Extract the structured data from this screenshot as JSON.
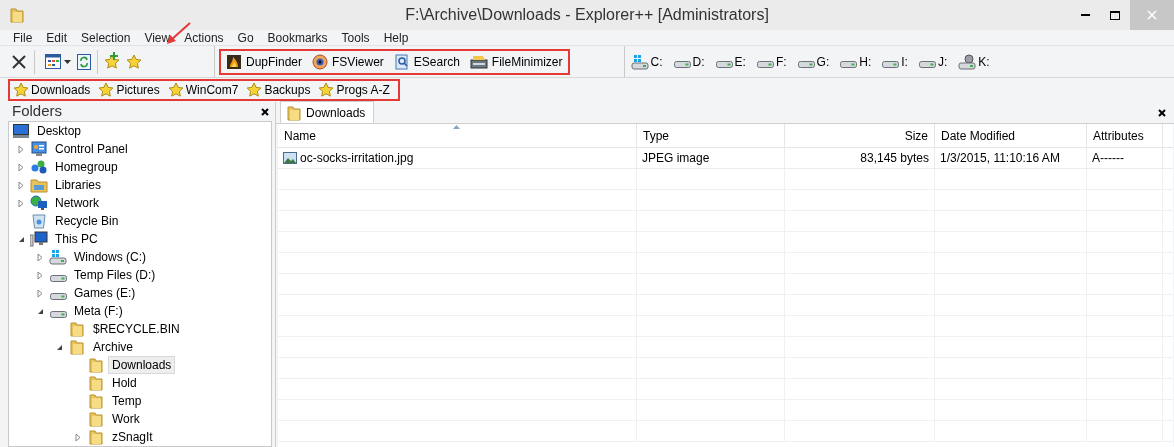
{
  "window": {
    "title": "F:\\Archive\\Downloads - Explorer++ [Administrators]"
  },
  "menu": [
    "File",
    "Edit",
    "Selection",
    "View",
    "Actions",
    "Go",
    "Bookmarks",
    "Tools",
    "Help"
  ],
  "apps": [
    {
      "label": "DupFinder",
      "kind": "flame"
    },
    {
      "label": "FSViewer",
      "kind": "eye"
    },
    {
      "label": "ESearch",
      "kind": "search"
    },
    {
      "label": "FileMinimizer",
      "kind": "scanner"
    }
  ],
  "drives": [
    {
      "label": "C:",
      "kind": "system"
    },
    {
      "label": "D:",
      "kind": "disk"
    },
    {
      "label": "E:",
      "kind": "disk"
    },
    {
      "label": "F:",
      "kind": "disk"
    },
    {
      "label": "G:",
      "kind": "disk"
    },
    {
      "label": "H:",
      "kind": "disk"
    },
    {
      "label": "I:",
      "kind": "disk"
    },
    {
      "label": "J:",
      "kind": "disk"
    },
    {
      "label": "K:",
      "kind": "network"
    }
  ],
  "bookmarks": [
    "Downloads",
    "Pictures",
    "WinCom7",
    "Backups",
    "Progs A-Z"
  ],
  "folders_panel": {
    "title": "Folders",
    "tree": [
      {
        "label": "Desktop",
        "kind": "desktop",
        "selected": false,
        "children": [
          {
            "label": "Control Panel",
            "kind": "control",
            "expanded": false,
            "selected": false
          },
          {
            "label": "Homegroup",
            "kind": "homegroup",
            "expanded": false,
            "selected": false
          },
          {
            "label": "Libraries",
            "kind": "libraries",
            "expanded": false,
            "selected": false
          },
          {
            "label": "Network",
            "kind": "network",
            "expanded": false,
            "selected": false
          },
          {
            "label": "Recycle Bin",
            "kind": "recycle",
            "selected": false
          },
          {
            "label": "This PC",
            "kind": "pc",
            "expanded": true,
            "selected": false,
            "children": [
              {
                "label": "Windows (C:)",
                "kind": "system",
                "expanded": false,
                "selected": false
              },
              {
                "label": "Temp Files (D:)",
                "kind": "disk",
                "expanded": false,
                "selected": false
              },
              {
                "label": "Games (E:)",
                "kind": "disk",
                "expanded": false,
                "selected": false
              },
              {
                "label": "Meta (F:)",
                "kind": "disk",
                "expanded": true,
                "selected": false,
                "children": [
                  {
                    "label": "$RECYCLE.BIN",
                    "kind": "folder",
                    "selected": false
                  },
                  {
                    "label": "Archive",
                    "kind": "folder",
                    "expanded": true,
                    "selected": false,
                    "children": [
                      {
                        "label": "Downloads",
                        "kind": "folder",
                        "selected": true
                      },
                      {
                        "label": "Hold",
                        "kind": "folder",
                        "selected": false
                      },
                      {
                        "label": "Temp",
                        "kind": "folder",
                        "selected": false
                      },
                      {
                        "label": "Work",
                        "kind": "folder",
                        "selected": false
                      },
                      {
                        "label": "zSnagIt",
                        "kind": "folder",
                        "expanded": false,
                        "selected": false
                      }
                    ]
                  }
                ]
              }
            ]
          }
        ]
      }
    ]
  },
  "tabs": [
    {
      "label": "Downloads",
      "selected": true
    }
  ],
  "table": {
    "columns": [
      "Name",
      "Type",
      "Size",
      "Date Modified",
      "Attributes"
    ],
    "rows": [
      {
        "name": "oc-socks-irritation.jpg",
        "type": "JPEG image",
        "size": "83,145 bytes",
        "date": "1/3/2015, 11:10:16 AM",
        "attributes": "A------"
      }
    ]
  }
}
